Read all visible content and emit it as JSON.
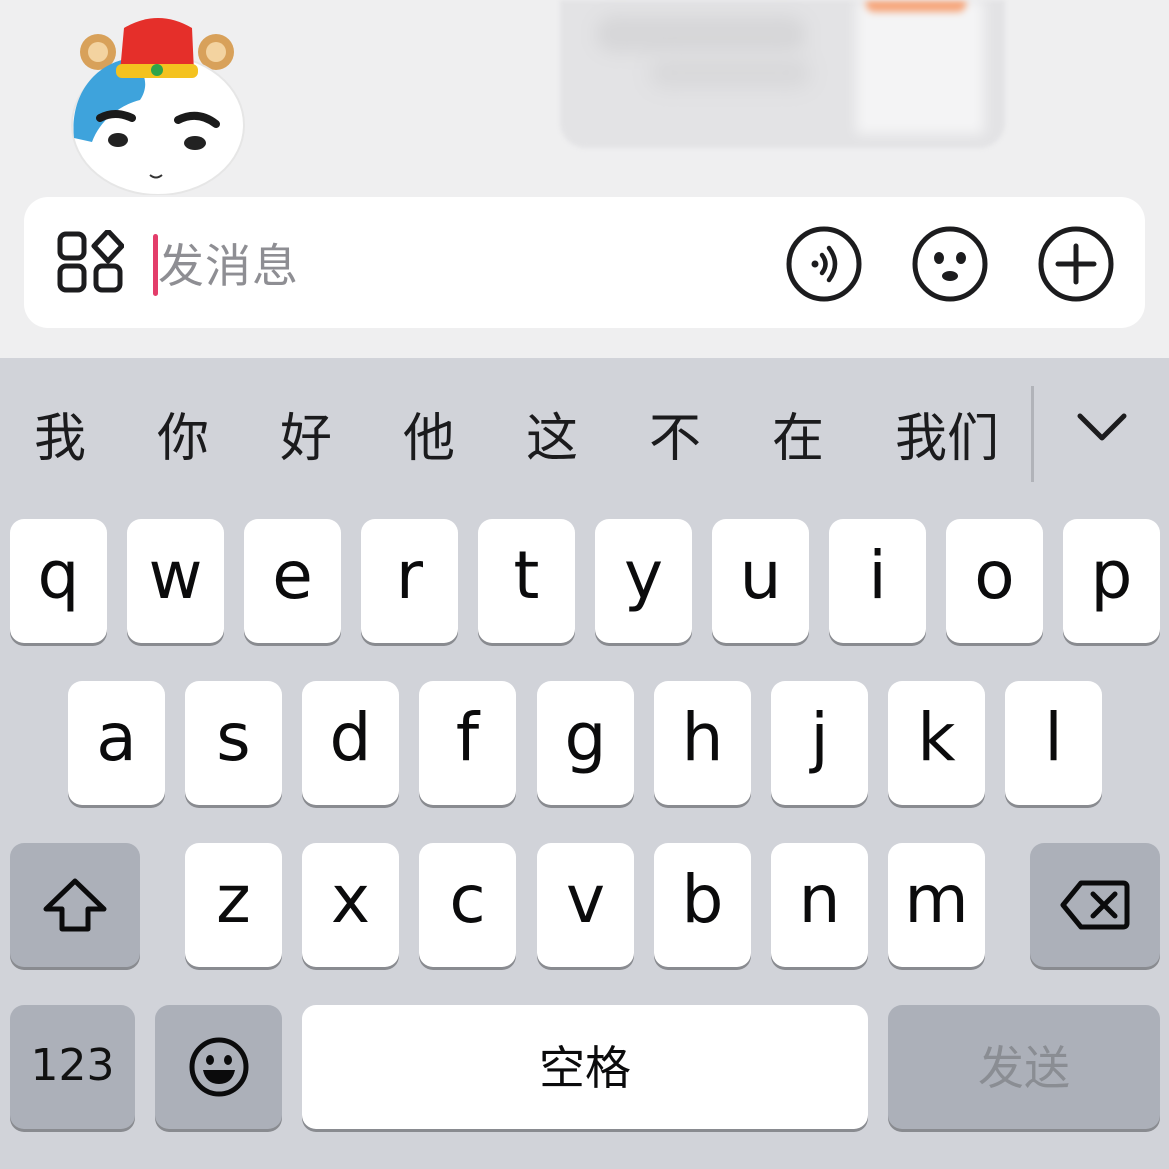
{
  "input": {
    "placeholder": "发消息"
  },
  "icons": {
    "apps": "apps-grid-icon",
    "voice": "voice-icon",
    "emoji": "emoji-face-icon",
    "add": "plus-circle-icon",
    "collapse": "chevron-down-icon",
    "shift": "shift-icon",
    "delete": "backspace-icon",
    "emoji_key": "emoji-key-icon"
  },
  "candidates": [
    "我",
    "你",
    "好",
    "他",
    "这",
    "不",
    "在",
    "我们"
  ],
  "keyboard": {
    "row1": [
      "q",
      "w",
      "e",
      "r",
      "t",
      "y",
      "u",
      "i",
      "o",
      "p"
    ],
    "row2": [
      "a",
      "s",
      "d",
      "f",
      "g",
      "h",
      "j",
      "k",
      "l"
    ],
    "row3": [
      "z",
      "x",
      "c",
      "v",
      "b",
      "n",
      "m"
    ],
    "num_key": "123",
    "space_key": "空格",
    "send_key": "发送"
  },
  "colors": {
    "cursor": "#e33d6a",
    "keyboard_bg": "#d1d3d9",
    "dark_key": "#acb0b9"
  }
}
